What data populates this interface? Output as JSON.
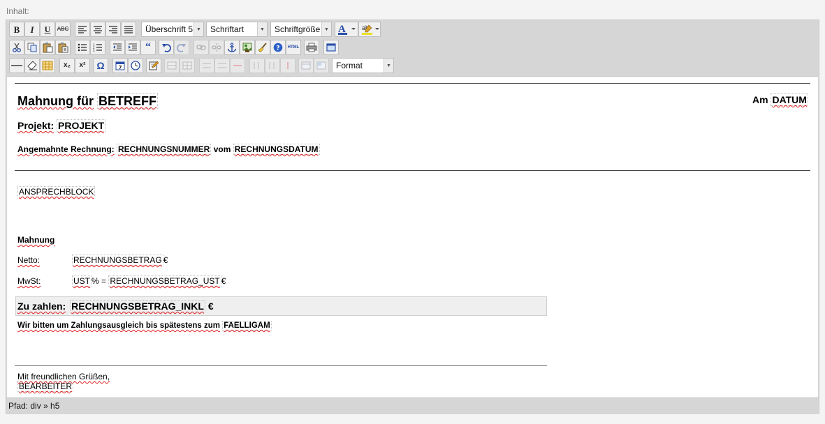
{
  "field_label": "Inhalt:",
  "toolbar": {
    "heading_select": "Überschrift 5",
    "font_select": "Schriftart",
    "size_select": "Schriftgröße",
    "format_select": "Format",
    "labels": {
      "bold": "B",
      "italic": "I",
      "underline": "U",
      "strikethrough": "ABC",
      "subscript": "x₂",
      "superscript": "x²",
      "special_char": "Ω",
      "html": "HTML"
    }
  },
  "document": {
    "title_prefix": "Mahnung für",
    "title_subject": "BETREFF",
    "date_prefix": "Am",
    "date_value": "DATUM",
    "project_label": "Projekt:",
    "project_value": "PROJEKT",
    "invoice_label": "Angemahnte Rechnung:",
    "invoice_number": "RECHNUNGSNUMMER",
    "invoice_connector": "vom",
    "invoice_date": "RECHNUNGSDATUM",
    "contact_block": "ANSPRECHBLOCK",
    "section_heading": "Mahnung",
    "net_label": "Netto:",
    "net_value": "RECHNUNGSBETRAG",
    "currency": "€",
    "vat_label": "MwSt:",
    "vat_percent": "UST",
    "vat_formula": "% =",
    "vat_value": "RECHNUNGSBETRAG_UST",
    "pay_label": "Zu zahlen:",
    "pay_value": "RECHNUNGSBETRAG_INKL",
    "payment_request": "Wir bitten um Zahlungsausgleich bis spätestens zum",
    "due_date": "FAELLIGAM",
    "closing": "Mit freundlichen Grüßen,",
    "editor_name": "BEARBEITER"
  },
  "status_path": "Pfad: div » h5",
  "colors": {
    "toolbar_bg": "#d6d6d6",
    "spell_underline": "#e02020",
    "link_blue": "#2a4fa8"
  }
}
